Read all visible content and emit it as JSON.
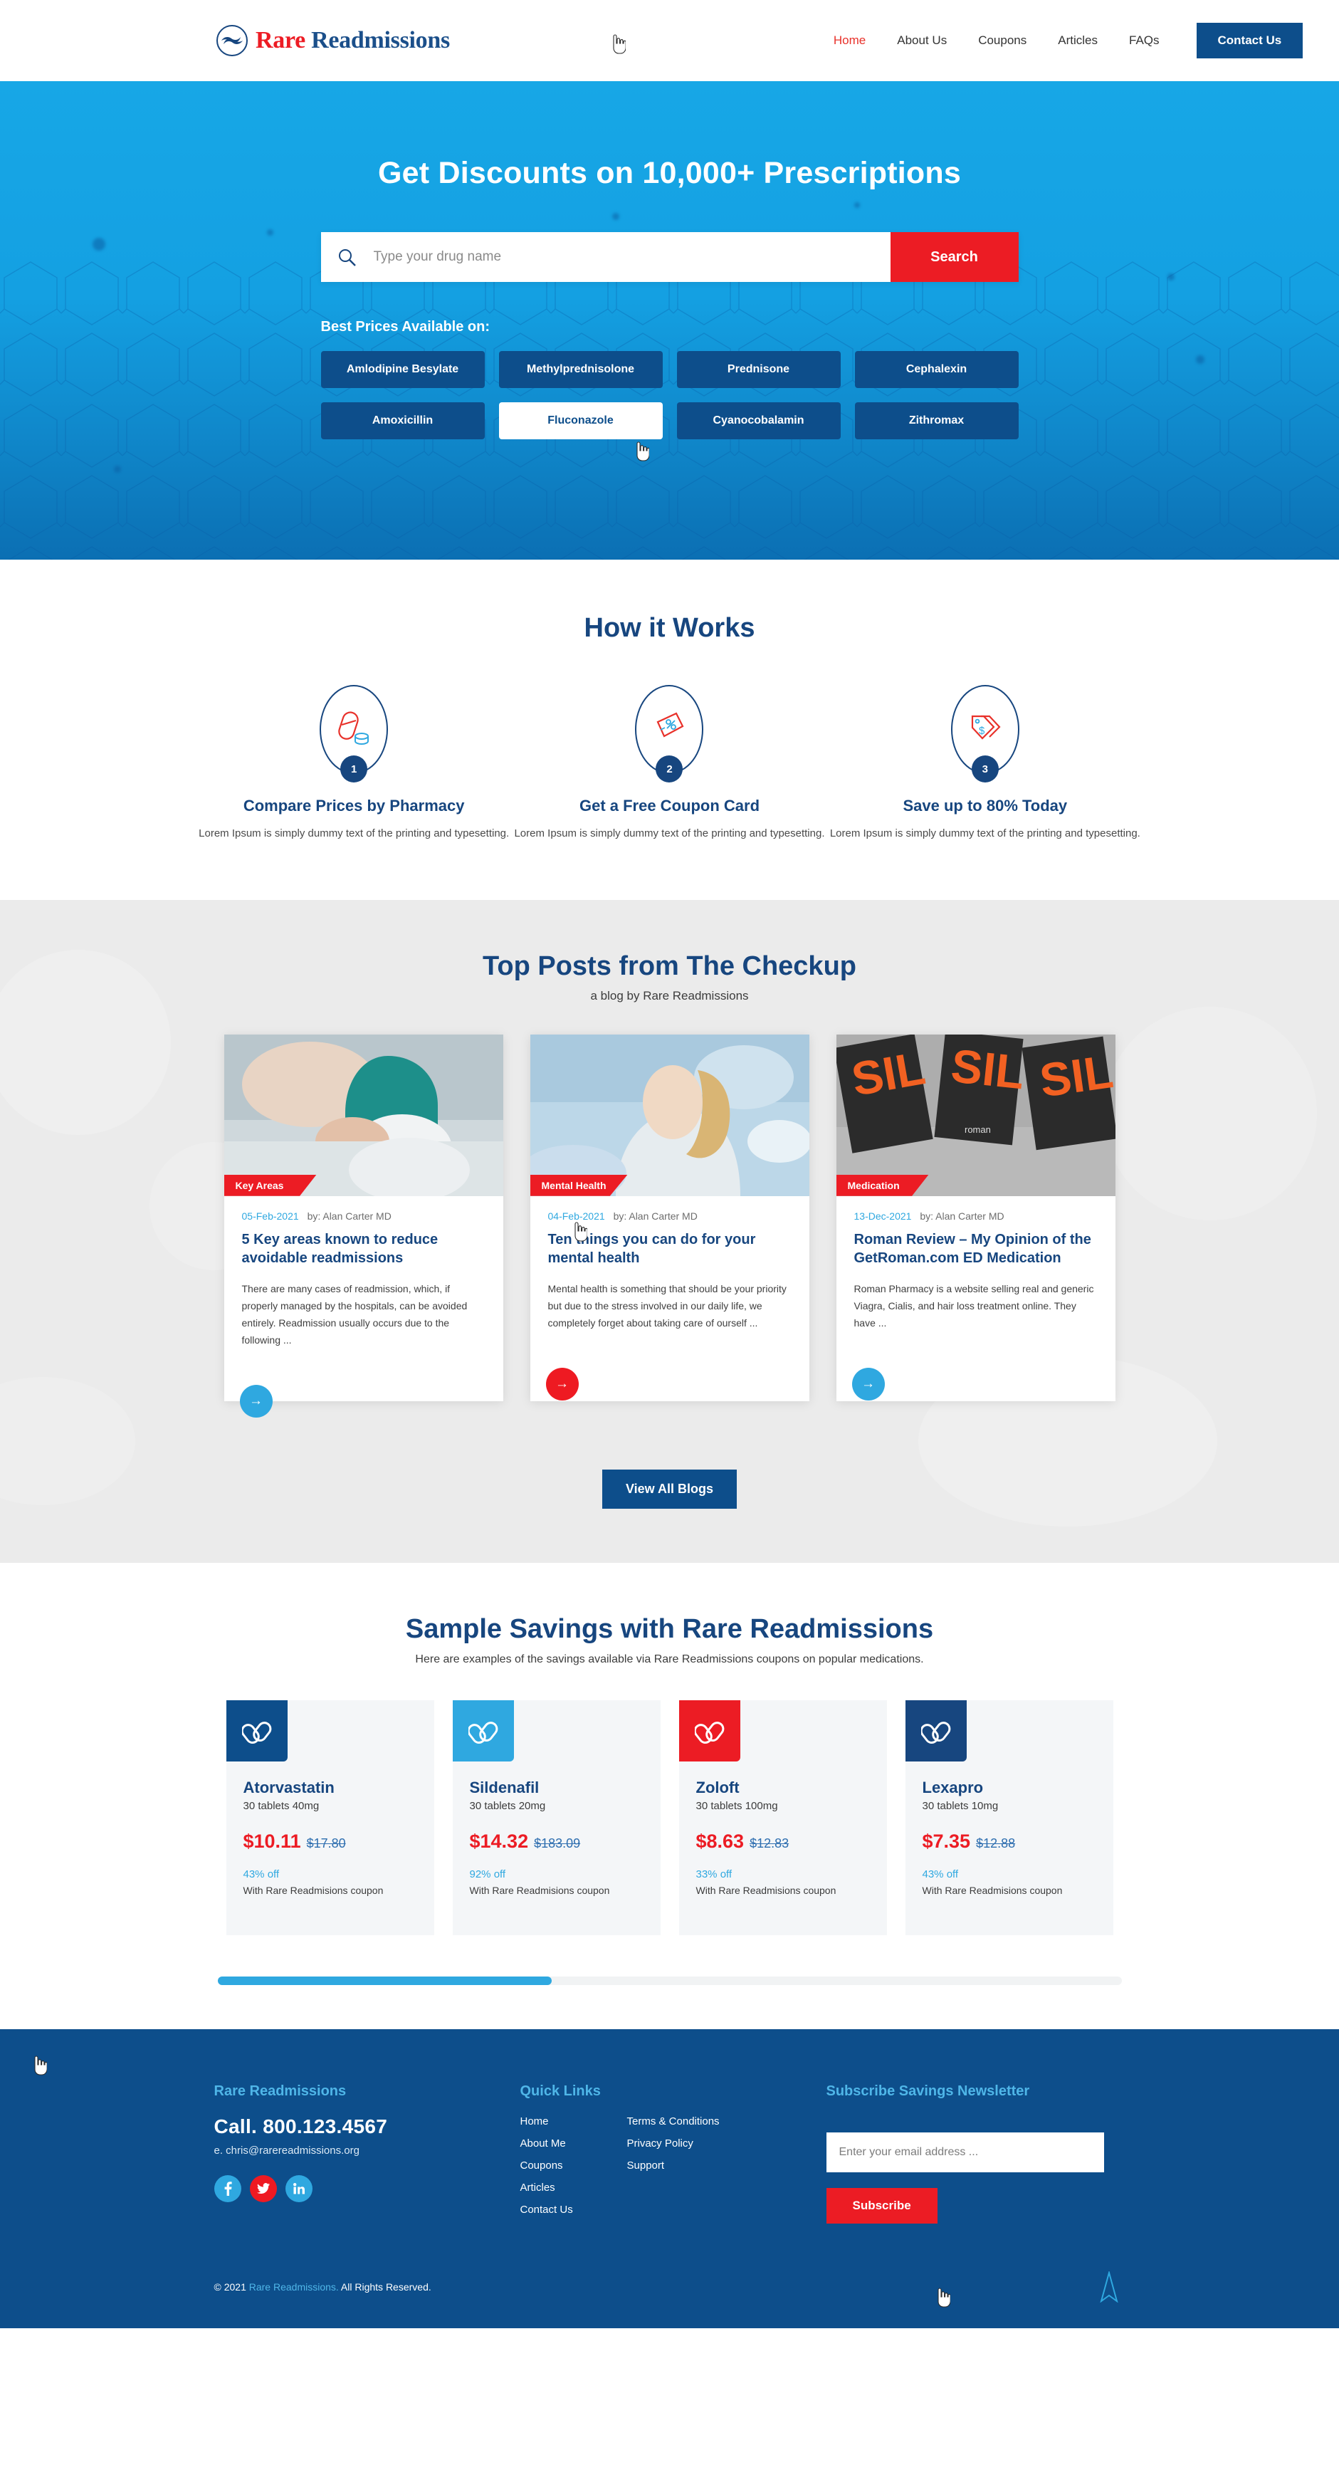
{
  "header": {
    "logo": {
      "name_red": "Rare",
      "name_blue": " Readmissions",
      "icon": "hands-circle-logo-icon"
    },
    "nav": [
      {
        "label": "Home",
        "active": true
      },
      {
        "label": "About Us",
        "active": false
      },
      {
        "label": "Coupons",
        "active": false
      },
      {
        "label": "Articles",
        "active": false
      },
      {
        "label": "FAQs",
        "active": false
      }
    ],
    "contact_label": "Contact Us"
  },
  "hero": {
    "title": "Get Discounts on 10,000+ Prescriptions",
    "search_placeholder": "Type your drug name",
    "search_value": "",
    "search_label": "Search",
    "best_prices_label": "Best Prices Available on:",
    "drugs": [
      {
        "label": "Amlodipine Besylate",
        "hovered": false
      },
      {
        "label": "Methylprednisolone",
        "hovered": false
      },
      {
        "label": "Prednisone",
        "hovered": false
      },
      {
        "label": "Cephalexin",
        "hovered": false
      },
      {
        "label": "Amoxicillin",
        "hovered": false
      },
      {
        "label": "Fluconazole",
        "hovered": true
      },
      {
        "label": "Cyanocobalamin",
        "hovered": false
      },
      {
        "label": "Zithromax",
        "hovered": false
      }
    ]
  },
  "how_it_works": {
    "title": "How it Works",
    "steps": [
      {
        "num": "1",
        "title": "Compare Prices by Pharmacy",
        "desc": "Lorem Ipsum is simply dummy text of the printing and typesetting.",
        "icon": "pill-capsule-icon"
      },
      {
        "num": "2",
        "title": "Get a Free Coupon Card",
        "desc": "Lorem Ipsum is simply dummy text of the printing and typesetting.",
        "icon": "coupon-percent-icon"
      },
      {
        "num": "3",
        "title": "Save up to 80% Today",
        "desc": "Lorem Ipsum is simply dummy text of the printing and typesetting.",
        "icon": "price-tag-dollar-icon"
      }
    ]
  },
  "blog": {
    "title": "Top Posts from The Checkup",
    "subtitle": "a blog by Rare Readmissions",
    "view_all_label": "View All Blogs",
    "posts": [
      {
        "tag": "Key Areas",
        "date": "05-Feb-2021",
        "author": "by: Alan Carter MD",
        "title": "5 Key areas known to reduce avoidable readmissions",
        "excerpt": "There are many cases of readmission, which, if properly managed by the hospitals, can be avoided entirely. Readmission usually occurs due to the following ...",
        "arrow_hovered": false,
        "image": "nurse-holding-patient-hand-photo"
      },
      {
        "tag": "Mental Health",
        "date": "04-Feb-2021",
        "author": "by: Alan Carter MD",
        "title": "Ten things you can do for your mental health",
        "excerpt": "Mental health is something that should be your priority but due to the stress involved in our daily life, we completely forget about taking care of ourself ...",
        "arrow_hovered": true,
        "image": "woman-looking-up-sky-photo"
      },
      {
        "tag": "Medication",
        "date": "13-Dec-2021",
        "author": "by: Alan Carter MD",
        "title": "Roman Review – My Opinion of the GetRoman.com ED Medication",
        "excerpt": "Roman Pharmacy is a website selling real and generic Viagra, Cialis, and hair loss treatment online. They have ...",
        "arrow_hovered": false,
        "image": "roman-packaging-sil-photo"
      }
    ]
  },
  "savings": {
    "title": "Sample Savings with Rare Readmissions",
    "subtitle": "Here are examples of the savings available via Rare Readmissions coupons on popular medications.",
    "scroll_percent": 37,
    "cards": [
      {
        "name": "Atorvastatin",
        "dose": "30 tablets 40mg",
        "new_price": "$10.11",
        "old_price": "$17.80",
        "off": "43% off",
        "with_text": "With Rare Readmisions coupon",
        "icon_color": "#0d4e8b",
        "icon": "pills-icon"
      },
      {
        "name": "Sildenafil",
        "dose": "30 tablets 20mg",
        "new_price": "$14.32",
        "old_price": "$183.09",
        "off": "92% off",
        "with_text": "With Rare Readmisions coupon",
        "icon_color": "#2fa8e0",
        "icon": "pills-icon"
      },
      {
        "name": "Zoloft",
        "dose": "30 tablets 100mg",
        "new_price": "$8.63",
        "old_price": "$12.83",
        "off": "33% off",
        "with_text": "With Rare Readmisions coupon",
        "icon_color": "#ec1c24",
        "icon": "pills-icon"
      },
      {
        "name": "Lexapro",
        "dose": "30 tablets 10mg",
        "new_price": "$7.35",
        "old_price": "$12.88",
        "off": "43% off",
        "with_text": "With Rare Readmisions coupon",
        "icon_color": "#17467f",
        "icon": "pills-icon"
      }
    ]
  },
  "footer": {
    "brand_head": "Rare Readmissions",
    "phone": "Call. 800.123.4567",
    "email": "e. chris@rarereadmissions.org",
    "socials": [
      {
        "name": "facebook-icon",
        "glyph": "f",
        "hovered": false
      },
      {
        "name": "twitter-icon",
        "glyph": "t",
        "hovered": true
      },
      {
        "name": "linkedin-icon",
        "glyph": "in",
        "hovered": false
      }
    ],
    "quick_links_head": "Quick Links",
    "links_col1": [
      "Home",
      "About Me",
      "Coupons",
      "Articles",
      "Contact Us"
    ],
    "links_col2": [
      "Terms & Conditions",
      "Privacy Policy",
      "Support"
    ],
    "newsletter_head": "Subscribe Savings Newsletter",
    "email_placeholder": "Enter your email address ...",
    "email_value": "",
    "subscribe_label": "Subscribe",
    "copyright_pre": "© 2021 ",
    "copyright_brand": "Rare Readmissions.",
    "copyright_post": " All Rights Reserved."
  },
  "colors": {
    "brand_blue": "#0d4e8b",
    "deep_blue": "#17467f",
    "light_blue": "#2fa8e0",
    "red": "#ec1c24",
    "hero_blue": "#14a0e2"
  }
}
